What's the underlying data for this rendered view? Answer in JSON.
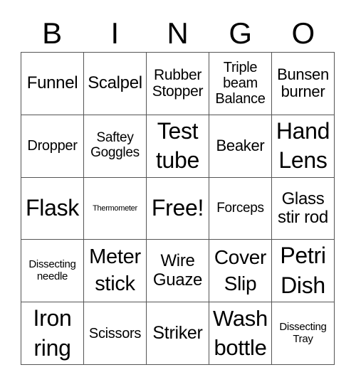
{
  "header": {
    "letters": [
      "B",
      "I",
      "N",
      "G",
      "O"
    ]
  },
  "cells": [
    "Funnel",
    "Scalpel",
    "Rubber\nStopper",
    "Triple\nbeam\nBalance",
    "Bunsen\nburner",
    "Dropper",
    "Saftey\nGoggles",
    "Test\ntube",
    "Beaker",
    "Hand\nLens",
    "Flask",
    "Thermometer",
    "Free!",
    "Forceps",
    "Glass\nstir rod",
    "Dissecting\nneedle",
    "Meter\nstick",
    "Wire\nGuaze",
    "Cover\nSlip",
    "Petri\nDish",
    "Iron\nring",
    "Scissors",
    "Striker",
    "Wash\nbottle",
    "Dissecting\nTray"
  ]
}
